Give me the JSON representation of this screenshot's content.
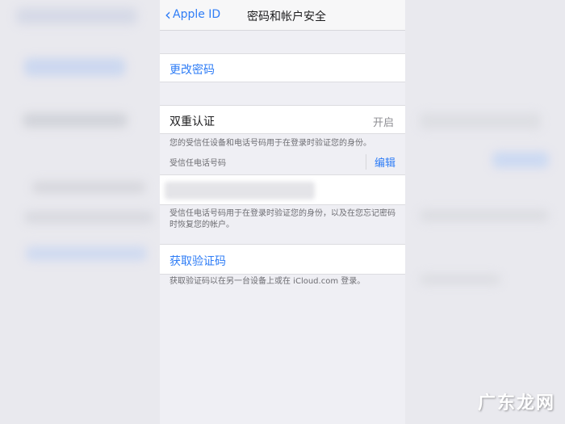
{
  "navbar": {
    "back_label": "Apple ID",
    "title": "密码和帐户安全"
  },
  "rows": {
    "change_password": "更改密码",
    "two_factor": {
      "label": "双重认证",
      "value": "开启"
    },
    "get_code": "获取验证码"
  },
  "notes": {
    "two_factor_desc": "您的受信任设备和电话号码用于在登录时验证您的身份。",
    "trusted_phone_header": "受信任电话号码",
    "edit_label": "编辑",
    "trusted_phone_desc": "受信任电话号码用于在登录时验证您的身份，以及在您忘记密码时恢复您的帐户。",
    "get_code_desc": "获取验证码以在另一台设备上或在 iCloud.com 登录。"
  },
  "watermark": "广东龙网",
  "colors": {
    "accent": "#2f7df6",
    "background": "#efeff4"
  }
}
